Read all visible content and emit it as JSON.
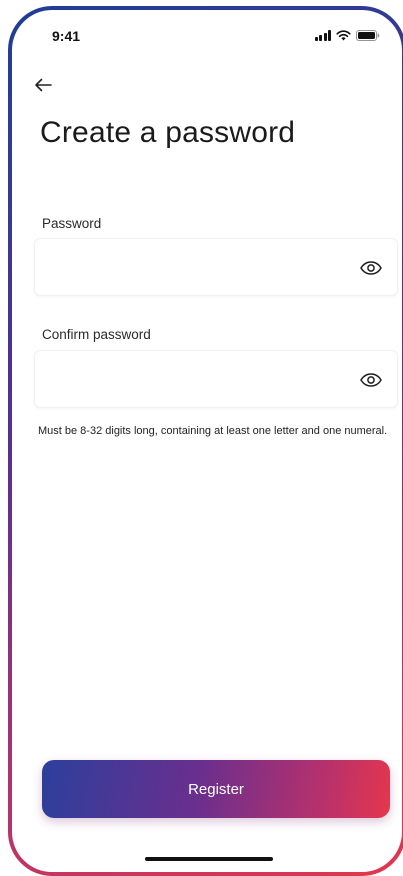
{
  "status_bar": {
    "time": "9:41",
    "icons": [
      "signal-icon",
      "wifi-icon",
      "battery-icon"
    ]
  },
  "header": {
    "back_icon": "arrow-left-icon",
    "title": "Create a password"
  },
  "form": {
    "password": {
      "label": "Password",
      "value": "",
      "toggle_icon": "eye-icon"
    },
    "confirm_password": {
      "label": "Confirm password",
      "value": "",
      "toggle_icon": "eye-icon"
    },
    "hint": "Must be 8-32 digits long, containing at least one letter and one numeral."
  },
  "actions": {
    "register_label": "Register"
  },
  "colors": {
    "gradient_start": "#2c3f9c",
    "gradient_mid": "#6a2f8e",
    "gradient_end": "#e5364e",
    "text": "#1b1b1b"
  }
}
